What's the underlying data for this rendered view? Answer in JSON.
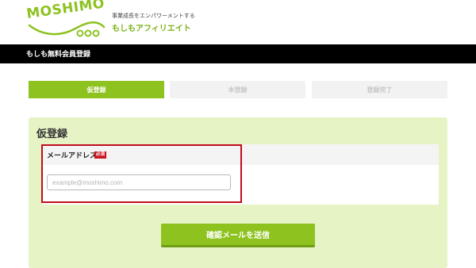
{
  "header": {
    "logo_text": "MOSHIMO",
    "tagline": "事業成長をエンパワーメントする",
    "brand": "もしもアフィリエイト"
  },
  "title_bar": {
    "text": "もしも無料会員登録"
  },
  "steps": [
    {
      "label": "仮登録",
      "state": "active"
    },
    {
      "label": "本登録",
      "state": "inactive"
    },
    {
      "label": "登録完了",
      "state": "inactive"
    }
  ],
  "form": {
    "title": "仮登録",
    "email_label": "メールアドレス",
    "required_badge": "必須",
    "email_value": "",
    "email_placeholder": "example@moshimo.com",
    "submit_label": "確認メールを送信"
  },
  "colors": {
    "accent": "#8dc21f",
    "panel_bg": "#e6f3c5",
    "highlight": "#c00d1e",
    "required": "#c9151e"
  }
}
